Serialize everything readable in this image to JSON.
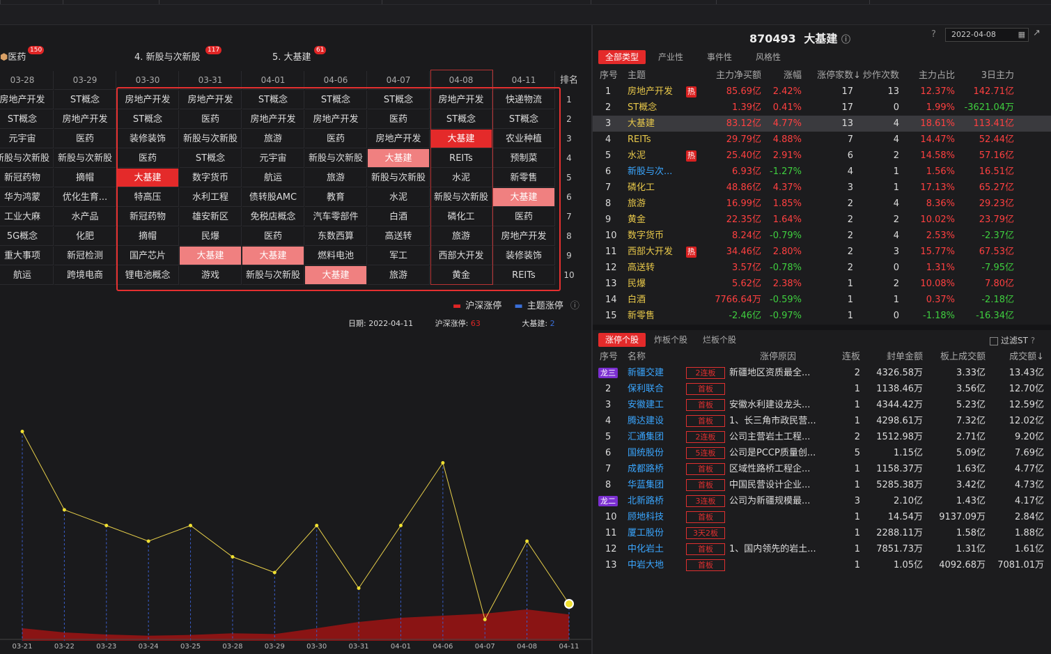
{
  "themes": [
    {
      "label": "医药",
      "count": "150"
    },
    {
      "label": "4. 新股与次新股",
      "count": "117"
    },
    {
      "label": "5. 大基建",
      "count": "61"
    }
  ],
  "grid": {
    "rank_header": "排名",
    "dates": [
      "03-28",
      "03-29",
      "03-30",
      "03-31",
      "04-01",
      "04-06",
      "04-07",
      "04-08",
      "04-11"
    ],
    "ranks": [
      "1",
      "2",
      "3",
      "4",
      "5",
      "6",
      "7",
      "8",
      "9",
      "10"
    ],
    "rows": [
      [
        "房地产开发",
        "ST概念",
        "房地产开发",
        "房地产开发",
        "ST概念",
        "ST概念",
        "ST概念",
        "房地产开发",
        "快递物流"
      ],
      [
        "ST概念",
        "房地产开发",
        "ST概念",
        "医药",
        "房地产开发",
        "房地产开发",
        "医药",
        "ST概念",
        "ST概念"
      ],
      [
        "元宇宙",
        "医药",
        "装修装饰",
        "新股与次新股",
        "旅游",
        "医药",
        "房地产开发",
        "大基建",
        "农业种植"
      ],
      [
        "新股与次新股",
        "新股与次新股",
        "医药",
        "ST概念",
        "元宇宙",
        "新股与次新股",
        "大基建",
        "REITs",
        "预制菜"
      ],
      [
        "新冠药物",
        "摘帽",
        "大基建",
        "数字货币",
        "航运",
        "旅游",
        "新股与次新股",
        "水泥",
        "新零售"
      ],
      [
        "华为鸿蒙",
        "优化生育...",
        "特高压",
        "水利工程",
        "债转股AMC",
        "教育",
        "水泥",
        "新股与次新股",
        "大基建"
      ],
      [
        "工业大麻",
        "水产品",
        "新冠药物",
        "雄安新区",
        "免税店概念",
        "汽车零部件",
        "白酒",
        "磷化工",
        "医药"
      ],
      [
        "5G概念",
        "化肥",
        "摘帽",
        "民爆",
        "医药",
        "东数西算",
        "高送转",
        "旅游",
        "房地产开发"
      ],
      [
        "重大事项",
        "新冠检测",
        "国产芯片",
        "大基建",
        "大基建",
        "燃料电池",
        "军工",
        "西部大开发",
        "装修装饰"
      ],
      [
        "航运",
        "跨境电商",
        "锂电池概念",
        "游戏",
        "新股与次新股",
        "大基建",
        "旅游",
        "黄金",
        "REITs"
      ]
    ]
  },
  "legend": {
    "a": "沪深涨停",
    "b": "主题涨停"
  },
  "info": {
    "date_label": "日期:",
    "date": "2022-04-11",
    "hs_label": "沪深涨停:",
    "hs_val": "63",
    "theme_label": "大基建:",
    "theme_val": "2"
  },
  "chart_data": {
    "type": "line",
    "x": [
      "03-21",
      "03-22",
      "03-23",
      "03-24",
      "03-25",
      "03-28",
      "03-29",
      "03-30",
      "03-31",
      "04-01",
      "04-06",
      "04-07",
      "04-08",
      "04-11"
    ],
    "series": [
      {
        "name": "沪深涨停",
        "values": [
          30,
          20,
          15,
          12,
          14,
          18,
          16,
          30,
          45,
          55,
          60,
          65,
          75,
          63
        ],
        "color": "#e02525"
      },
      {
        "name": "主题涨停",
        "values": [
          13,
          8,
          7,
          6,
          7,
          5,
          4,
          7,
          3,
          7,
          11,
          1,
          6,
          2
        ],
        "color": "#e8d04a"
      }
    ]
  },
  "stock": {
    "code": "870493",
    "name": "大基建",
    "date": "2022-04-08"
  },
  "tabs1": [
    "全部类型",
    "产业性",
    "事件性",
    "风格性"
  ],
  "table1": {
    "headers": [
      "序号",
      "主题",
      "主力净买额",
      "涨幅",
      "涨停家数↓",
      "炒作次数",
      "主力占比",
      "3日主力"
    ],
    "rows": [
      [
        "1",
        "房地产开发",
        "热",
        "85.69亿",
        "2.42%",
        "17",
        "13",
        "12.37%",
        "142.71亿"
      ],
      [
        "2",
        "ST概念",
        "",
        "1.39亿",
        "0.41%",
        "17",
        "0",
        "1.99%",
        "-3621.04万"
      ],
      [
        "3",
        "大基建",
        "",
        "83.12亿",
        "4.77%",
        "13",
        "4",
        "18.61%",
        "113.41亿"
      ],
      [
        "4",
        "REITs",
        "",
        "29.79亿",
        "4.88%",
        "7",
        "4",
        "14.47%",
        "52.44亿"
      ],
      [
        "5",
        "水泥",
        "热",
        "25.40亿",
        "2.91%",
        "6",
        "2",
        "14.58%",
        "57.16亿"
      ],
      [
        "6",
        "新股与次...",
        "",
        "6.93亿",
        "-1.27%",
        "4",
        "1",
        "1.56%",
        "16.51亿"
      ],
      [
        "7",
        "磷化工",
        "",
        "48.86亿",
        "4.37%",
        "3",
        "1",
        "17.13%",
        "65.27亿"
      ],
      [
        "8",
        "旅游",
        "",
        "16.99亿",
        "1.85%",
        "2",
        "4",
        "8.36%",
        "29.23亿"
      ],
      [
        "9",
        "黄金",
        "",
        "22.35亿",
        "1.64%",
        "2",
        "2",
        "10.02%",
        "23.79亿"
      ],
      [
        "10",
        "数字货币",
        "",
        "8.24亿",
        "-0.79%",
        "2",
        "4",
        "2.53%",
        "-2.37亿"
      ],
      [
        "11",
        "西部大开发",
        "热",
        "34.46亿",
        "2.80%",
        "2",
        "3",
        "15.77%",
        "67.53亿"
      ],
      [
        "12",
        "高送转",
        "",
        "3.57亿",
        "-0.78%",
        "2",
        "0",
        "1.31%",
        "-7.95亿"
      ],
      [
        "13",
        "民爆",
        "",
        "5.62亿",
        "2.38%",
        "1",
        "2",
        "10.08%",
        "7.80亿"
      ],
      [
        "14",
        "白酒",
        "",
        "7766.64万",
        "-0.59%",
        "1",
        "1",
        "0.37%",
        "-2.18亿"
      ],
      [
        "15",
        "新零售",
        "",
        "-2.46亿",
        "-0.97%",
        "1",
        "0",
        "-1.18%",
        "-16.34亿"
      ]
    ]
  },
  "tabs2": [
    "涨停个股",
    "炸板个股",
    "烂板个股"
  ],
  "filter_st": "过滤ST",
  "table2": {
    "headers": [
      "序号",
      "名称",
      "涨停原因",
      "连板",
      "封单金额",
      "板上成交额",
      "成交额↓"
    ],
    "rows": [
      [
        "龙三",
        "新疆交建",
        "2连板",
        "新疆地区资质最全...",
        "2",
        "4326.58万",
        "3.33亿",
        "13.43亿"
      ],
      [
        "2",
        "保利联合",
        "首板",
        "",
        "1",
        "1138.46万",
        "3.56亿",
        "12.70亿"
      ],
      [
        "3",
        "安徽建工",
        "首板",
        "安徽水利建设龙头...",
        "1",
        "4344.42万",
        "5.23亿",
        "12.59亿"
      ],
      [
        "4",
        "腾达建设",
        "首板",
        "1、长三角市政民营...",
        "1",
        "4298.61万",
        "7.32亿",
        "12.02亿"
      ],
      [
        "5",
        "汇通集团",
        "2连板",
        "公司主营岩土工程...",
        "2",
        "1512.98万",
        "2.71亿",
        "9.20亿"
      ],
      [
        "6",
        "国统股份",
        "5连板",
        "公司是PCCP质量创...",
        "5",
        "1.15亿",
        "5.09亿",
        "7.69亿"
      ],
      [
        "7",
        "成都路桥",
        "首板",
        "区域性路桥工程企...",
        "1",
        "1158.37万",
        "1.63亿",
        "4.77亿"
      ],
      [
        "8",
        "华蓝集团",
        "首板",
        "中国民营设计企业...",
        "1",
        "5285.38万",
        "3.42亿",
        "4.73亿"
      ],
      [
        "龙二",
        "北新路桥",
        "3连板",
        "公司为新疆规模最...",
        "3",
        "2.10亿",
        "1.43亿",
        "4.17亿"
      ],
      [
        "10",
        "顾地科技",
        "首板",
        "",
        "1",
        "14.54万",
        "9137.09万",
        "2.84亿"
      ],
      [
        "11",
        "厦工股份",
        "3天2板",
        "",
        "1",
        "2288.11万",
        "1.58亿",
        "1.88亿"
      ],
      [
        "12",
        "中化岩土",
        "首板",
        "1、国内领先的岩土...",
        "1",
        "7851.73万",
        "1.31亿",
        "1.61亿"
      ],
      [
        "13",
        "中岩大地",
        "首板",
        "",
        "1",
        "1.05亿",
        "4092.68万",
        "7081.01万"
      ]
    ]
  }
}
